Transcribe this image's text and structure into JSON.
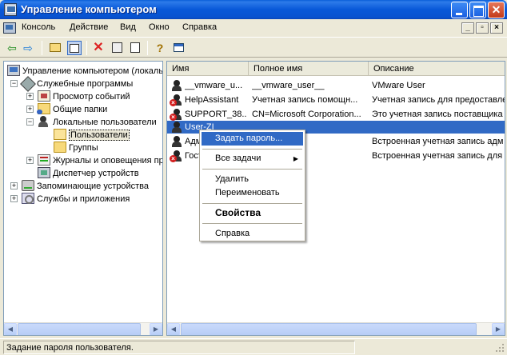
{
  "window": {
    "title": "Управление компьютером"
  },
  "menubar": {
    "items": [
      "Консоль",
      "Действие",
      "Вид",
      "Окно",
      "Справка"
    ]
  },
  "toolbar": {
    "icons": [
      "back-icon",
      "forward-icon",
      "up-folder-icon",
      "show-hide-tree-icon",
      "delete-icon",
      "properties-icon",
      "export-icon",
      "help-icon",
      "show-console-icon"
    ]
  },
  "tree": {
    "items": [
      "Управление компьютером (локаль",
      "Служебные программы",
      "Просмотр событий",
      "Общие папки",
      "Локальные пользователи",
      "Пользователи",
      "Группы",
      "Журналы и оповещения пр",
      "Диспетчер устройств",
      "Запоминающие устройства",
      "Службы и приложения"
    ]
  },
  "list": {
    "columns": [
      "Имя",
      "Полное имя",
      "Описание"
    ],
    "rows": [
      {
        "name": "__vmware_u...",
        "full_name": "__vmware_user__",
        "description": "VMware User"
      },
      {
        "name": "HelpAssistant",
        "full_name": "Учетная запись помощн...",
        "description": "Учетная запись для предоставле"
      },
      {
        "name": "SUPPORT_38...",
        "full_name": "CN=Microsoft Corporation...",
        "description": "Это учетная запись поставщика"
      },
      {
        "name": "User-ZI",
        "full_name": "",
        "description": ""
      },
      {
        "name": "Адм",
        "full_name": "",
        "description": "Встроенная учетная запись адм"
      },
      {
        "name": "Гост",
        "full_name": "",
        "description": "Встроенная учетная запись для д"
      }
    ]
  },
  "context_menu": {
    "items": [
      "Задать пароль...",
      "Все задачи",
      "Удалить",
      "Переименовать",
      "Свойства",
      "Справка"
    ]
  },
  "statusbar": {
    "text": "Задание пароля пользователя."
  }
}
